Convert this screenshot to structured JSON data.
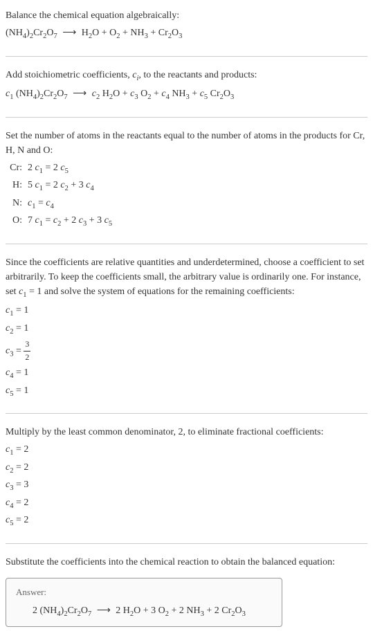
{
  "intro": {
    "line1": "Balance the chemical equation algebraically:",
    "eq_lhs": "(NH₄)₂Cr₂O₇",
    "eq_rhs": "H₂O + O₂ + NH₃ + Cr₂O₃"
  },
  "stoich": {
    "line1_a": "Add stoichiometric coefficients, ",
    "line1_b": ", to the reactants and products:",
    "ci": "c",
    "ci_sub": "i",
    "eq": "c₁ (NH₄)₂Cr₂O₇  ⟶  c₂ H₂O + c₃ O₂ + c₄ NH₃ + c₅ Cr₂O₃"
  },
  "atoms": {
    "line1": "Set the number of atoms in the reactants equal to the number of atoms in the products for Cr, H, N and O:",
    "rows": [
      {
        "el": "Cr:",
        "eq": "2 c₁ = 2 c₅"
      },
      {
        "el": "H:",
        "eq": "5 c₁ = 2 c₂ + 3 c₄"
      },
      {
        "el": "N:",
        "eq": "c₁ = c₄"
      },
      {
        "el": "O:",
        "eq": "7 c₁ = c₂ + 2 c₃ + 3 c₅"
      }
    ]
  },
  "solve": {
    "para": "Since the coefficients are relative quantities and underdetermined, choose a coefficient to set arbitrarily. To keep the coefficients small, the arbitrary value is ordinarily one. For instance, set c₁ = 1 and solve the system of equations for the remaining coefficients:",
    "coefs": [
      "c₁ = 1",
      "c₂ = 1",
      "c₃ = ",
      "c₄ = 1",
      "c₅ = 1"
    ],
    "frac_num": "3",
    "frac_den": "2"
  },
  "multiply": {
    "para": "Multiply by the least common denominator, 2, to eliminate fractional coefficients:",
    "coefs": [
      "c₁ = 2",
      "c₂ = 2",
      "c₃ = 3",
      "c₄ = 2",
      "c₅ = 2"
    ]
  },
  "final": {
    "para": "Substitute the coefficients into the chemical reaction to obtain the balanced equation:",
    "answer_label": "Answer:",
    "answer_eq": "2 (NH₄)₂Cr₂O₇  ⟶  2 H₂O + 3 O₂ + 2 NH₃ + 2 Cr₂O₃"
  },
  "arrow": "⟶"
}
